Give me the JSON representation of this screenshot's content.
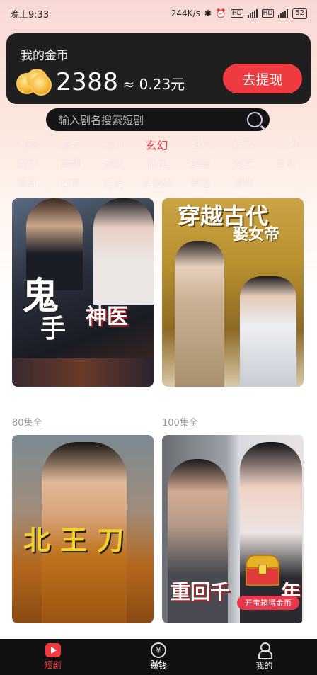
{
  "status_bar": {
    "time": "晚上9:33",
    "network_speed": "244K/s",
    "battery": "52",
    "icons": [
      "bluetooth-icon",
      "alarm-icon",
      "hd-icon",
      "signal-icon",
      "wifi-icon"
    ]
  },
  "coin_card": {
    "title": "我的金币",
    "amount": "2388",
    "approx_value": "≈ 0.23元",
    "withdraw_label": "去提现"
  },
  "search": {
    "placeholder": "输入剧名搜索短剧"
  },
  "categories": {
    "rows": [
      [
        "推荐",
        "都市",
        "热血",
        "玄幻",
        "甜宠",
        "校园",
        "古风"
      ],
      [
        "魔幻",
        "高甜",
        "家庭",
        "暴躁",
        "逆袭",
        "恋爱",
        "乡村"
      ],
      [
        "喵片",
        "古言",
        "历史",
        "其他类",
        "兽炮",
        "修仙"
      ]
    ],
    "active": "玄幻"
  },
  "dramas": [
    {
      "title_a": "鬼",
      "title_b": "手",
      "title_c": "神医",
      "episodes": "80集全"
    },
    {
      "title_a": "穿越古代",
      "title_b": "娶女帝",
      "episodes": "100集全"
    },
    {
      "title_a": "北王刀",
      "episodes": ""
    },
    {
      "title_a": "重回千",
      "title_b": "年"
    }
  ],
  "treasure": {
    "label": "开宝箱得金币"
  },
  "tabbar": {
    "items": [
      {
        "label": "短剧",
        "icon": "play-icon",
        "active": true
      },
      {
        "label": "赚钱",
        "icon": "yen-icon",
        "active": false
      },
      {
        "label": "我的",
        "icon": "user-icon",
        "active": false
      }
    ],
    "page_indicator": "2/4"
  },
  "colors": {
    "accent": "#ef3b3f",
    "card_bg": "#1f1f1f",
    "tabbar_bg": "#111111"
  }
}
